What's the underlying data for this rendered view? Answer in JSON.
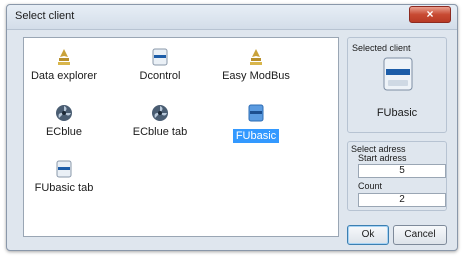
{
  "window": {
    "title": "Select client",
    "close_glyph": "×"
  },
  "clients": [
    {
      "label": "Data explorer",
      "icon": "pen-tool-icon",
      "selected": false
    },
    {
      "label": "Dcontrol",
      "icon": "device-icon",
      "selected": false
    },
    {
      "label": "Easy ModBus",
      "icon": "pen-tool-icon",
      "selected": false
    },
    {
      "label": "ECblue",
      "icon": "fan-icon",
      "selected": false
    },
    {
      "label": "ECblue tab",
      "icon": "fan-icon",
      "selected": false
    },
    {
      "label": "FUbasic",
      "icon": "device-icon",
      "selected": true
    },
    {
      "label": "FUbasic tab",
      "icon": "device-icon",
      "selected": false
    }
  ],
  "selected_client": {
    "heading": "Selected client",
    "name": "FUbasic",
    "icon": "device-icon"
  },
  "adress": {
    "heading": "Select adress",
    "start_label": "Start adress",
    "start_value": "5",
    "count_label": "Count",
    "count_value": "2"
  },
  "buttons": {
    "ok": "Ok",
    "cancel": "Cancel"
  },
  "colors": {
    "selection": "#3399ff",
    "close_button": "#c84a33"
  }
}
